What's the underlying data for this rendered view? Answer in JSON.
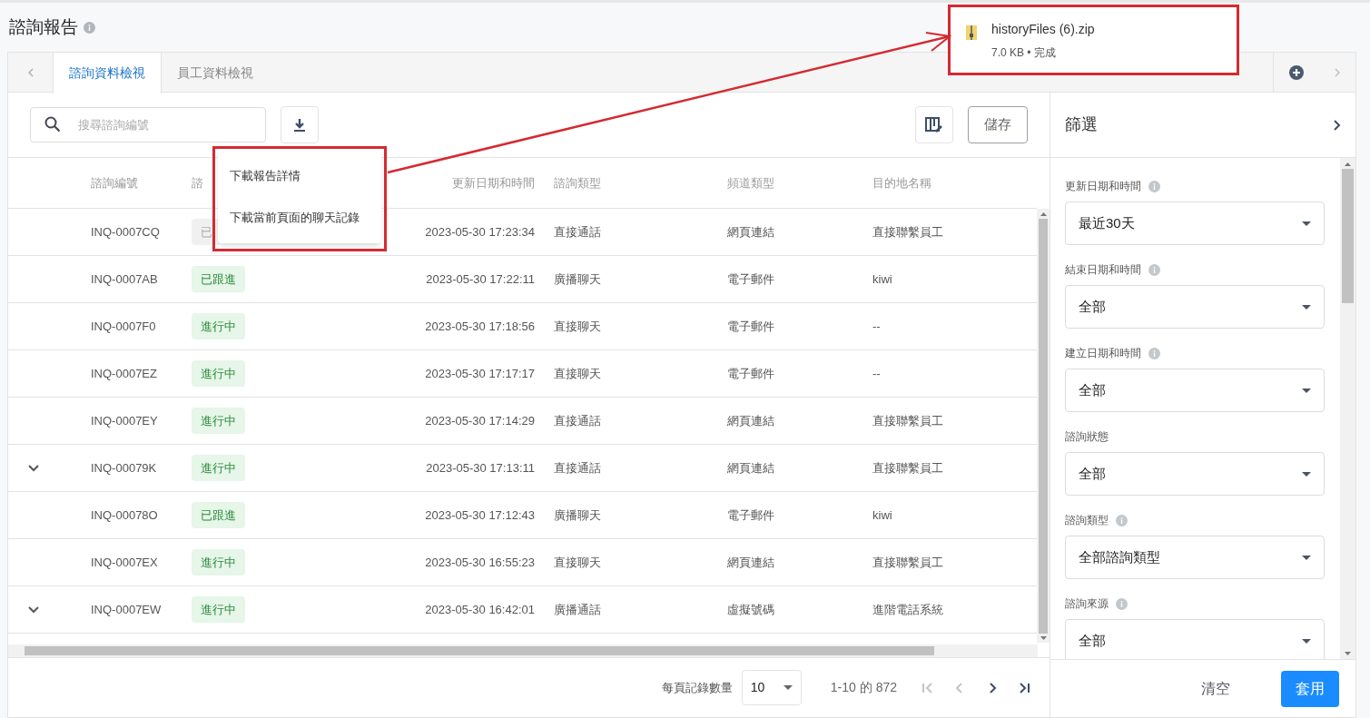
{
  "page_title": "諮詢報告",
  "tabs": [
    {
      "label": "諮詢資料檢視",
      "selected": true
    },
    {
      "label": "員工資料檢視",
      "selected": false
    }
  ],
  "toolbar": {
    "search_placeholder": "搜尋諮詢編號",
    "save_label": "儲存"
  },
  "download_menu": {
    "items": [
      "下載報告詳情",
      "下載當前頁面的聊天記錄"
    ]
  },
  "download_bubble": {
    "file_name": "historyFiles (6).zip",
    "details": "7.0 KB • 完成"
  },
  "table": {
    "columns": [
      "諮詢編號",
      "諮",
      "更新日期和時間",
      "諮詢類型",
      "頻道類型",
      "目的地名稱"
    ],
    "rows": [
      {
        "expandable": false,
        "id": "INQ-0007CQ",
        "status": "已",
        "muted": true,
        "updated": "2023-05-30 17:23:34",
        "type": "直接通話",
        "channel": "網頁連結",
        "destination": "直接聯繫員工"
      },
      {
        "expandable": false,
        "id": "INQ-0007AB",
        "status": "已跟進",
        "muted": false,
        "updated": "2023-05-30 17:22:11",
        "type": "廣播聊天",
        "channel": "電子郵件",
        "destination": "kiwi"
      },
      {
        "expandable": false,
        "id": "INQ-0007F0",
        "status": "進行中",
        "muted": false,
        "updated": "2023-05-30 17:18:56",
        "type": "直接聊天",
        "channel": "電子郵件",
        "destination": "--"
      },
      {
        "expandable": false,
        "id": "INQ-0007EZ",
        "status": "進行中",
        "muted": false,
        "updated": "2023-05-30 17:17:17",
        "type": "直接聊天",
        "channel": "電子郵件",
        "destination": "--"
      },
      {
        "expandable": false,
        "id": "INQ-0007EY",
        "status": "進行中",
        "muted": false,
        "updated": "2023-05-30 17:14:29",
        "type": "直接通話",
        "channel": "網頁連結",
        "destination": "直接聯繫員工"
      },
      {
        "expandable": true,
        "id": "INQ-00079K",
        "status": "進行中",
        "muted": false,
        "updated": "2023-05-30 17:13:11",
        "type": "直接通話",
        "channel": "網頁連結",
        "destination": "直接聯繫員工"
      },
      {
        "expandable": false,
        "id": "INQ-00078O",
        "status": "已跟進",
        "muted": false,
        "updated": "2023-05-30 17:12:43",
        "type": "廣播聊天",
        "channel": "電子郵件",
        "destination": "kiwi"
      },
      {
        "expandable": false,
        "id": "INQ-0007EX",
        "status": "進行中",
        "muted": false,
        "updated": "2023-05-30 16:55:23",
        "type": "直接聊天",
        "channel": "網頁連結",
        "destination": "直接聯繫員工"
      },
      {
        "expandable": true,
        "id": "INQ-0007EW",
        "status": "進行中",
        "muted": false,
        "updated": "2023-05-30 16:42:01",
        "type": "廣播通話",
        "channel": "虛擬號碼",
        "destination": "進階電話系統"
      }
    ]
  },
  "pagination": {
    "rows_per_page_label": "每頁記錄數量",
    "rows_per_page": "10",
    "range": "1-10 的 872",
    "first_disabled": true,
    "prev_disabled": true,
    "next_disabled": false,
    "last_disabled": false
  },
  "filter_panel": {
    "title": "篩選",
    "filters": [
      {
        "label": "更新日期和時間",
        "info": true,
        "value": "最近30天"
      },
      {
        "label": "結束日期和時間",
        "info": true,
        "value": "全部"
      },
      {
        "label": "建立日期和時間",
        "info": true,
        "value": "全部"
      },
      {
        "label": "諮詢狀態",
        "info": false,
        "value": "全部"
      },
      {
        "label": "諮詢類型",
        "info": true,
        "value": "全部諮詢類型"
      },
      {
        "label": "諮詢來源",
        "info": true,
        "value": "全部"
      }
    ],
    "clear_label": "清空",
    "apply_label": "套用"
  }
}
